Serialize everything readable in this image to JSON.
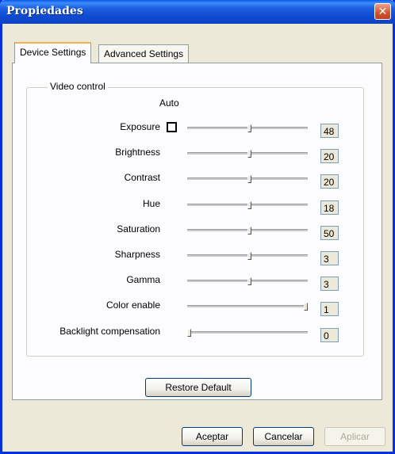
{
  "window": {
    "title": "Propiedades"
  },
  "tabs": [
    {
      "label": "Device Settings",
      "active": true
    },
    {
      "label": "Advanced Settings",
      "active": false
    }
  ],
  "video_control": {
    "group_label": "Video control",
    "auto_label": "Auto",
    "rows": [
      {
        "label": "Exposure",
        "value": "48",
        "slider_percent": 52,
        "has_auto_checkbox": true,
        "auto_checked": false
      },
      {
        "label": "Brightness",
        "value": "20",
        "slider_percent": 52,
        "has_auto_checkbox": false
      },
      {
        "label": "Contrast",
        "value": "20",
        "slider_percent": 52,
        "has_auto_checkbox": false
      },
      {
        "label": "Hue",
        "value": "18",
        "slider_percent": 52,
        "has_auto_checkbox": false
      },
      {
        "label": "Saturation",
        "value": "50",
        "slider_percent": 52,
        "has_auto_checkbox": false
      },
      {
        "label": "Sharpness",
        "value": "3",
        "slider_percent": 52,
        "has_auto_checkbox": false
      },
      {
        "label": "Gamma",
        "value": "3",
        "slider_percent": 52,
        "has_auto_checkbox": false
      },
      {
        "label": "Color enable",
        "value": "1",
        "slider_percent": 100,
        "has_auto_checkbox": false
      },
      {
        "label": "Backlight compensation",
        "value": "0",
        "slider_percent": 0,
        "has_auto_checkbox": false
      }
    ]
  },
  "restore_default_label": "Restore Default",
  "footer": {
    "ok_label": "Aceptar",
    "cancel_label": "Cancelar",
    "apply_label": "Aplicar",
    "apply_enabled": false
  },
  "colors": {
    "titlebar": "#0c4bd1",
    "close_button": "#d2532f",
    "dialog_background": "#ece9d8",
    "tab_highlight": "#f3b54b"
  },
  "icons": {
    "close": "close-icon"
  }
}
